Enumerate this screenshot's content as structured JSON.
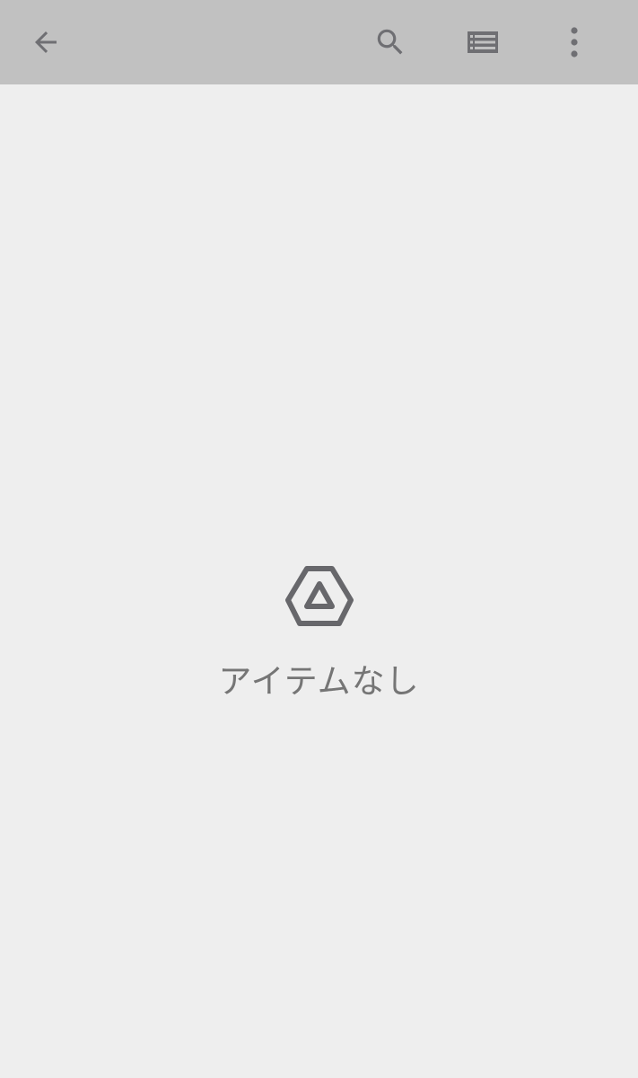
{
  "toolbar": {
    "background_color": "#c1c1c1",
    "icon_color": "#6f6f73",
    "back_icon": "arrow-back-icon",
    "search_icon": "search-icon",
    "list_view_icon": "list-view-icon",
    "more_icon": "more-vert-icon"
  },
  "empty_state": {
    "icon": "drive-logo-icon",
    "message": "アイテムなし",
    "text_color": "#757575"
  },
  "page": {
    "background_color": "#eeeeee"
  }
}
